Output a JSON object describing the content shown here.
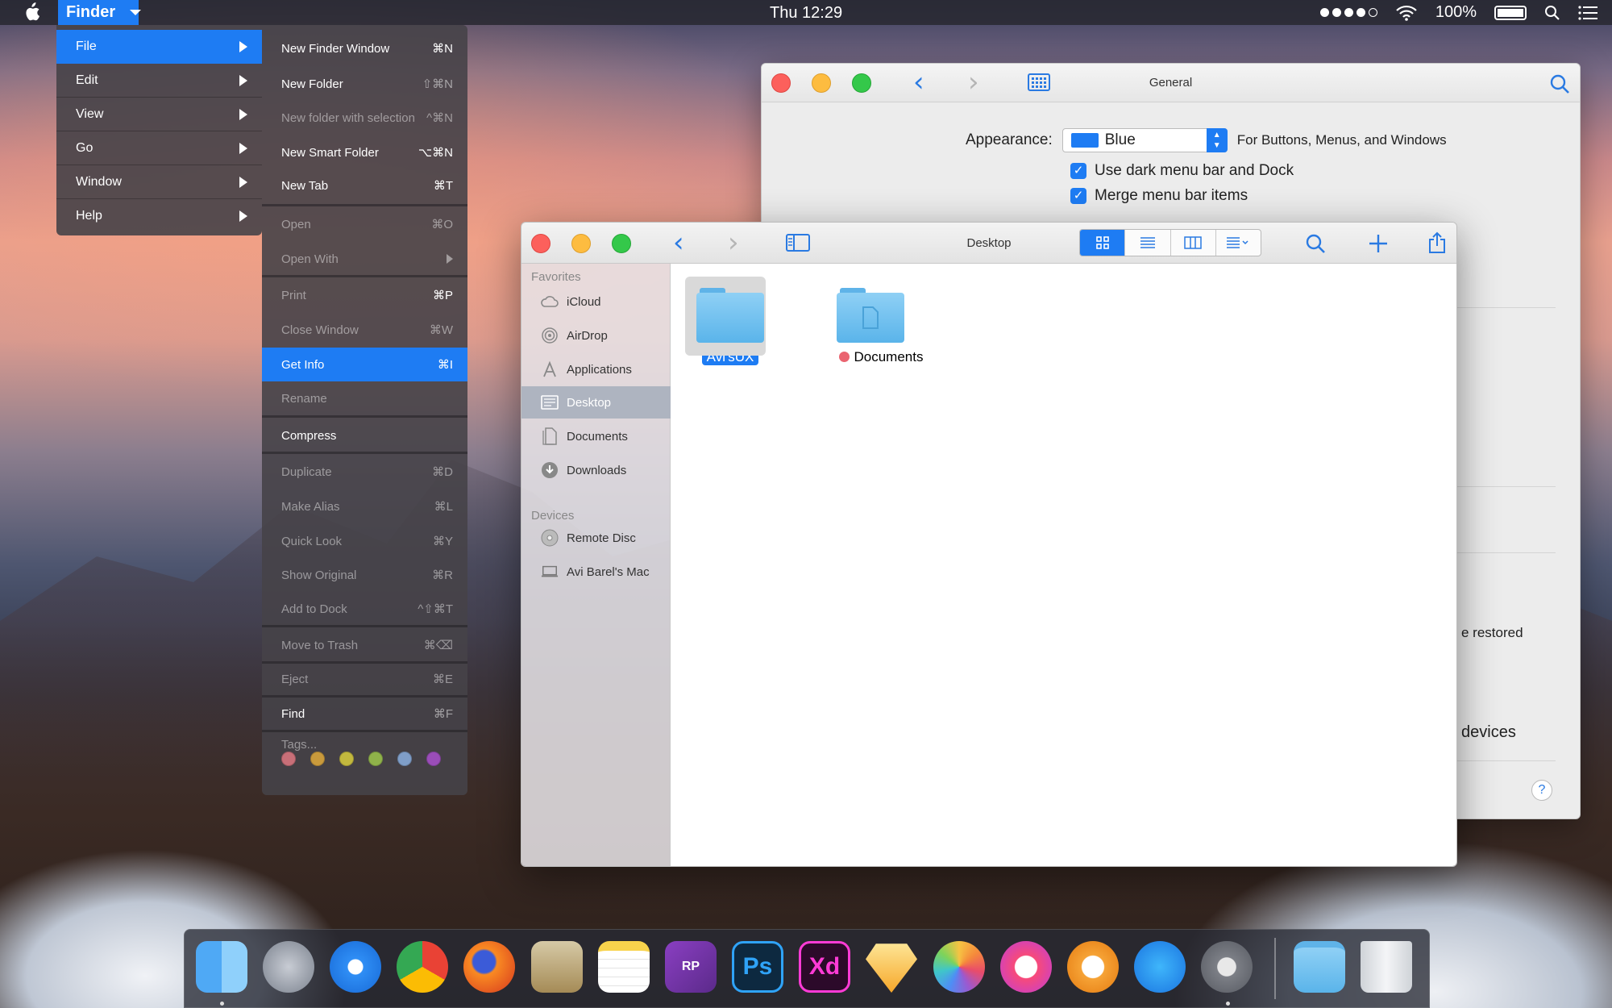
{
  "menubar": {
    "app_name": "Finder",
    "clock": "Thu 12:29",
    "battery": "100%"
  },
  "file_submenu": {
    "items": [
      {
        "label": "File"
      },
      {
        "label": "Edit"
      },
      {
        "label": "View"
      },
      {
        "label": "Go"
      },
      {
        "label": "Window"
      },
      {
        "label": "Help"
      }
    ]
  },
  "file_menu": {
    "items": [
      {
        "label": "New Finder Window",
        "shortcut": "⌘N"
      },
      {
        "label": "New Folder",
        "shortcut": "⇧⌘N"
      },
      {
        "label": "New folder with selection",
        "shortcut": "^⌘N"
      },
      {
        "label": "New Smart Folder",
        "shortcut": "⌥⌘N"
      },
      {
        "label": "New Tab",
        "shortcut": "⌘T"
      },
      {
        "label": "Open",
        "shortcut": "⌘O"
      },
      {
        "label": "Open With",
        "shortcut": ""
      },
      {
        "label": "Print",
        "shortcut": "⌘P"
      },
      {
        "label": "Close Window",
        "shortcut": "⌘W"
      },
      {
        "label": "Get Info",
        "shortcut": "⌘I"
      },
      {
        "label": "Rename",
        "shortcut": ""
      },
      {
        "label": "Compress",
        "shortcut": ""
      },
      {
        "label": "Duplicate",
        "shortcut": "⌘D"
      },
      {
        "label": "Make Alias",
        "shortcut": "⌘L"
      },
      {
        "label": "Quick Look",
        "shortcut": "⌘Y"
      },
      {
        "label": "Show Original",
        "shortcut": "⌘R"
      },
      {
        "label": "Add to Dock",
        "shortcut": "^⇧⌘T"
      },
      {
        "label": "Move to Trash",
        "shortcut": "⌘⌫"
      },
      {
        "label": "Eject",
        "shortcut": "⌘E"
      },
      {
        "label": "Find",
        "shortcut": "⌘F"
      },
      {
        "label": "Tags...",
        "shortcut": ""
      }
    ],
    "tag_colors": [
      "#c86f78",
      "#c99a3c",
      "#c2b83e",
      "#8fb24a",
      "#7f9ec8",
      "#9a4db8"
    ]
  },
  "general_window": {
    "title": "General",
    "appearance_label": "Appearance:",
    "appearance_value": "Blue",
    "appearance_note": "For Buttons, Menus, and Windows",
    "check1": "Use dark menu bar and Dock",
    "check2": "Merge menu bar items",
    "partial1": "e restored",
    "partial2": "devices",
    "help": "?"
  },
  "finder_window": {
    "title": "Desktop",
    "favorites_header": "Favorites",
    "devices_header": "Devices",
    "favorites": [
      {
        "label": "iCloud",
        "icon": "cloud-icon"
      },
      {
        "label": "AirDrop",
        "icon": "airdrop-icon"
      },
      {
        "label": "Applications",
        "icon": "applications-icon"
      },
      {
        "label": "Desktop",
        "icon": "desktop-icon"
      },
      {
        "label": "Documents",
        "icon": "documents-icon"
      },
      {
        "label": "Downloads",
        "icon": "downloads-icon"
      }
    ],
    "devices": [
      {
        "label": "Remote Disc",
        "icon": "disc-icon"
      },
      {
        "label": "Avi Barel's Mac",
        "icon": "laptop-icon"
      }
    ],
    "files": [
      {
        "label": "Avi'sUX"
      },
      {
        "label": "Documents"
      }
    ]
  },
  "dock": {
    "apps": [
      {
        "label": "",
        "icon": "finder-icon"
      },
      {
        "label": "",
        "icon": "launchpad-icon"
      },
      {
        "label": "",
        "icon": "safari-icon"
      },
      {
        "label": "",
        "icon": "chrome-icon"
      },
      {
        "label": "",
        "icon": "firefox-icon"
      },
      {
        "label": "",
        "icon": "mail-icon"
      },
      {
        "label": "",
        "icon": "notes-icon"
      },
      {
        "label": "RP",
        "icon": "axure-icon"
      },
      {
        "label": "Ps",
        "icon": "photoshop-icon"
      },
      {
        "label": "Xd",
        "icon": "xd-icon"
      },
      {
        "label": "",
        "icon": "sketch-icon"
      },
      {
        "label": "",
        "icon": "photos-icon"
      },
      {
        "label": "",
        "icon": "itunes-icon"
      },
      {
        "label": "",
        "icon": "ibooks-icon"
      },
      {
        "label": "",
        "icon": "appstore-icon"
      },
      {
        "label": "",
        "icon": "system-preferences-icon"
      },
      {
        "label": "",
        "icon": "downloads-folder-icon"
      },
      {
        "label": "",
        "icon": "trash-icon"
      }
    ]
  }
}
